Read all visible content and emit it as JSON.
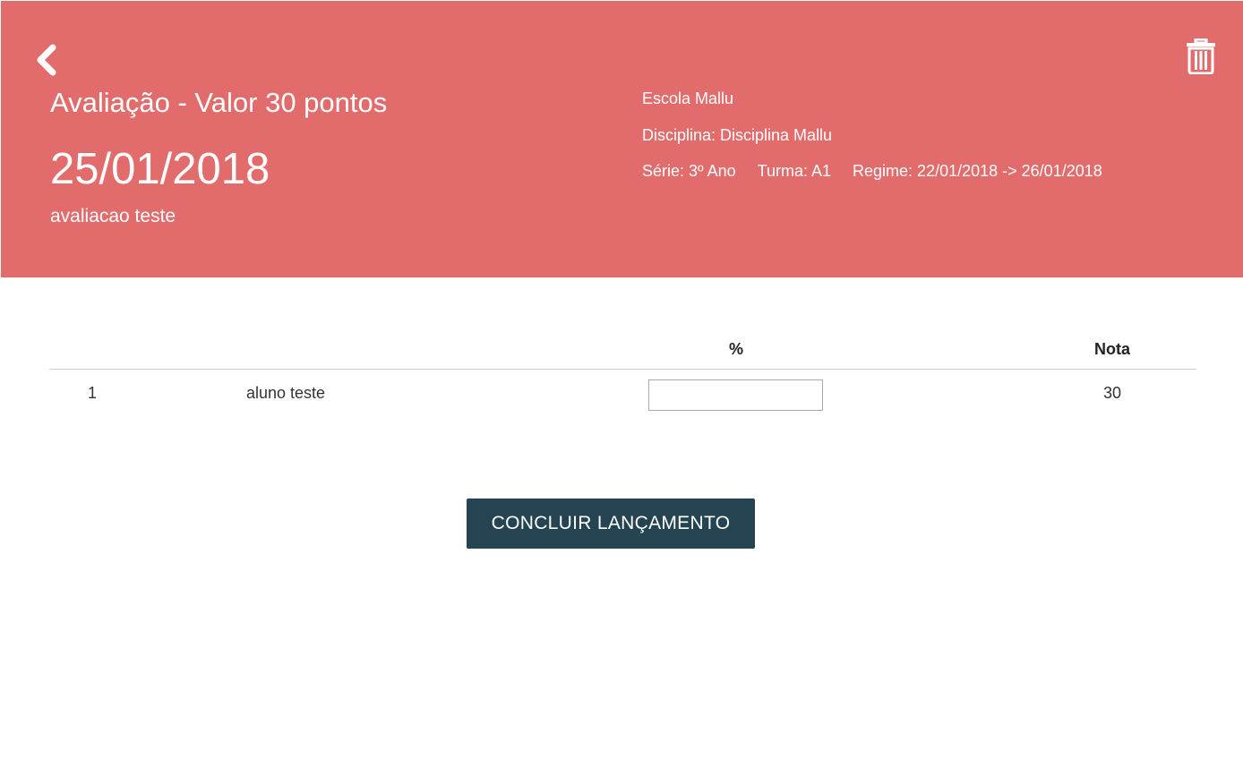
{
  "header": {
    "title": "Avaliação - Valor 30 pontos",
    "date": "25/01/2018",
    "description": "avaliacao teste",
    "school": "Escola Mallu",
    "discipline": "Disciplina: Disciplina Mallu",
    "serie": "Série: 3º Ano",
    "turma": "Turma: A1",
    "regime": "Regime: 22/01/2018 -> 26/01/2018",
    "back_icon": "chevron-left-icon",
    "delete_icon": "trash-icon",
    "background_color": "#e26c6b"
  },
  "table": {
    "columns": [
      "",
      "",
      "%",
      "Nota"
    ],
    "rows": [
      {
        "number": "1",
        "name": "aluno teste",
        "percent": "",
        "grade": "30"
      }
    ]
  },
  "actions": {
    "submit_label": "CONCLUIR LANÇAMENTO",
    "submit_color": "#244452"
  }
}
